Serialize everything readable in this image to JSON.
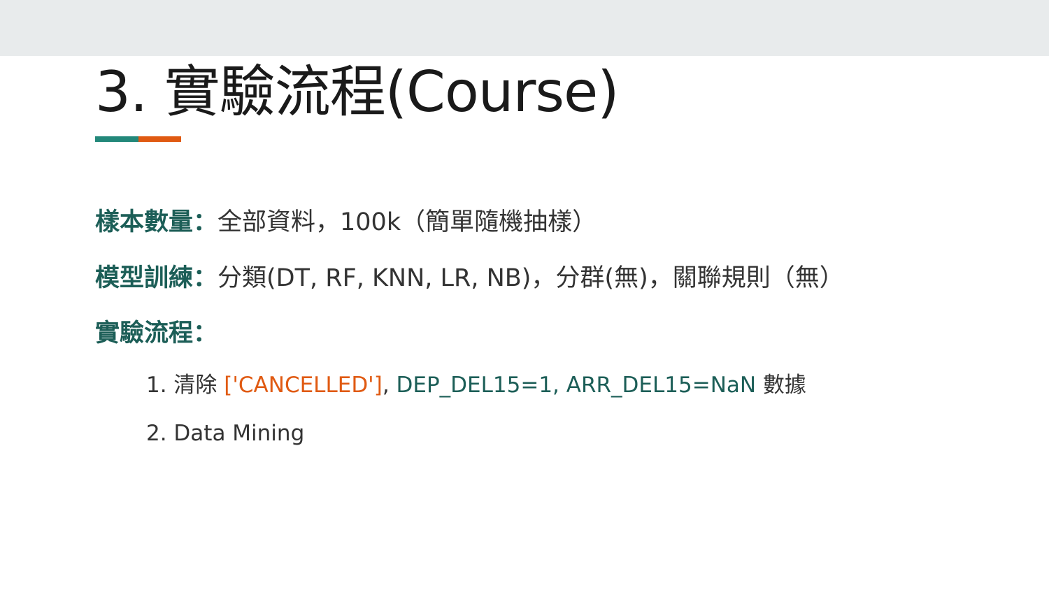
{
  "slide": {
    "title": "3. 實驗流程(Course)",
    "accent_colors": {
      "teal": "#23887a",
      "orange": "#e05a12"
    },
    "rows": [
      {
        "label": "樣本數量：",
        "text": "全部資料，100k（簡單隨機抽樣）"
      },
      {
        "label": "模型訓練：",
        "text": "分類(DT, RF, KNN, LR, NB)，分群(無)，關聯規則（無）"
      },
      {
        "label": "實驗流程：",
        "text": ""
      }
    ],
    "steps": {
      "step1": {
        "prefix": "1. 清除 ",
        "cancelled": "['CANCELLED']",
        "comma": ",",
        "conditions": " DEP_DEL15=1, ARR_DEL15=NaN",
        "suffix": " 數據"
      },
      "step2": {
        "text": "2. Data Mining"
      }
    }
  }
}
